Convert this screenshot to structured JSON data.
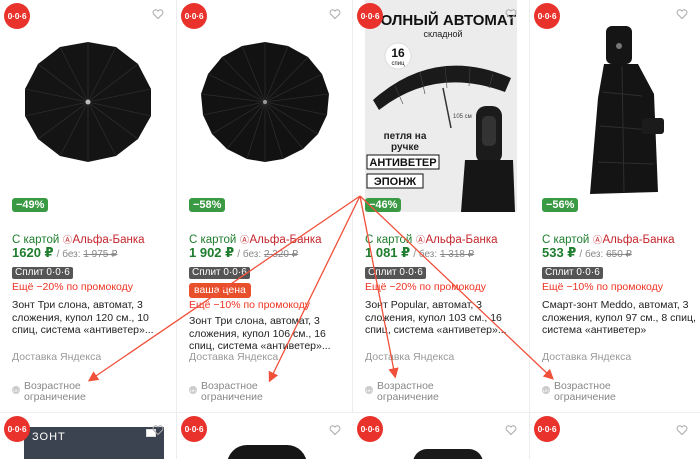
{
  "badge_label": "0·0·6",
  "products": [
    {
      "discount": "−49%",
      "card_label": "С картой",
      "bank": "Альфа-Банка",
      "price": "1620 ₽",
      "old_price_prefix": "/ без:",
      "old_price": "1 975 ₽",
      "split": "Сплит 0·0·6",
      "your_price": "",
      "promo": "Ещё −20% по промокоду",
      "title": "Зонт Три слона, автомат, 3 сложения, купол 120 см., 10 спиц, система «антиветер»...",
      "delivery": "Доставка Яндекса",
      "age": "Возрастное ограничение"
    },
    {
      "discount": "−58%",
      "card_label": "С картой",
      "bank": "Альфа-Банка",
      "price": "1 902 ₽",
      "old_price_prefix": "/ без:",
      "old_price": "2 320 ₽",
      "split": "Сплит 0·0·6",
      "your_price": "ваша цена",
      "promo": "Ещё −10% по промокоду",
      "title": "Зонт Три слона, автомат, 3 сложения, купол 106 см., 16 спиц, система «антиветер»...",
      "delivery": "Доставка Яндекса",
      "age": "Возрастное ограничение"
    },
    {
      "discount": "−46%",
      "card_label": "С картой",
      "bank": "Альфа-Банка",
      "price": "1 081 ₽",
      "old_price_prefix": "/ без:",
      "old_price": "1 318 ₽",
      "split": "Сплит 0·0·6",
      "your_price": "",
      "promo": "Ещё −20% по промокоду",
      "title": "Зонт Popular, автомат, 3 сложения, купол 103 см., 16 спиц, система «антиветер»...",
      "delivery": "Доставка Яндекса",
      "age": "Возрастное ограничение",
      "image_text": {
        "headline": "ПОЛНЫЙ АВТОМАТ",
        "sub": "складной",
        "spokes_num": "16",
        "spokes_word": "спиц",
        "size": "105 см",
        "loop1": "петля на",
        "loop2": "ручке",
        "wind": "АНТИВЕТЕР",
        "pongee": "ЭПОНЖ"
      }
    },
    {
      "discount": "−56%",
      "card_label": "С картой",
      "bank": "Альфа-Банка",
      "price": "533 ₽",
      "old_price_prefix": "/ без:",
      "old_price": "650 ₽",
      "split": "Сплит 0·0·6",
      "your_price": "",
      "promo": "Ещё −10% по промокоду",
      "title": "Смарт-зонт Meddo, автомат, 3 сложения, купол 97 см., 8 спиц, система «антиветер»",
      "delivery": "Доставка Яндекса",
      "age": "Возрастное ограничение"
    }
  ],
  "row2": {
    "card1_text": "ЗОНТ"
  },
  "colors": {
    "brand_red": "#e8322b",
    "discount_green": "#3a9a44",
    "price_green": "#1f7d2e",
    "promo_red": "#e32222",
    "annotation_arrow": "#f0503a"
  }
}
